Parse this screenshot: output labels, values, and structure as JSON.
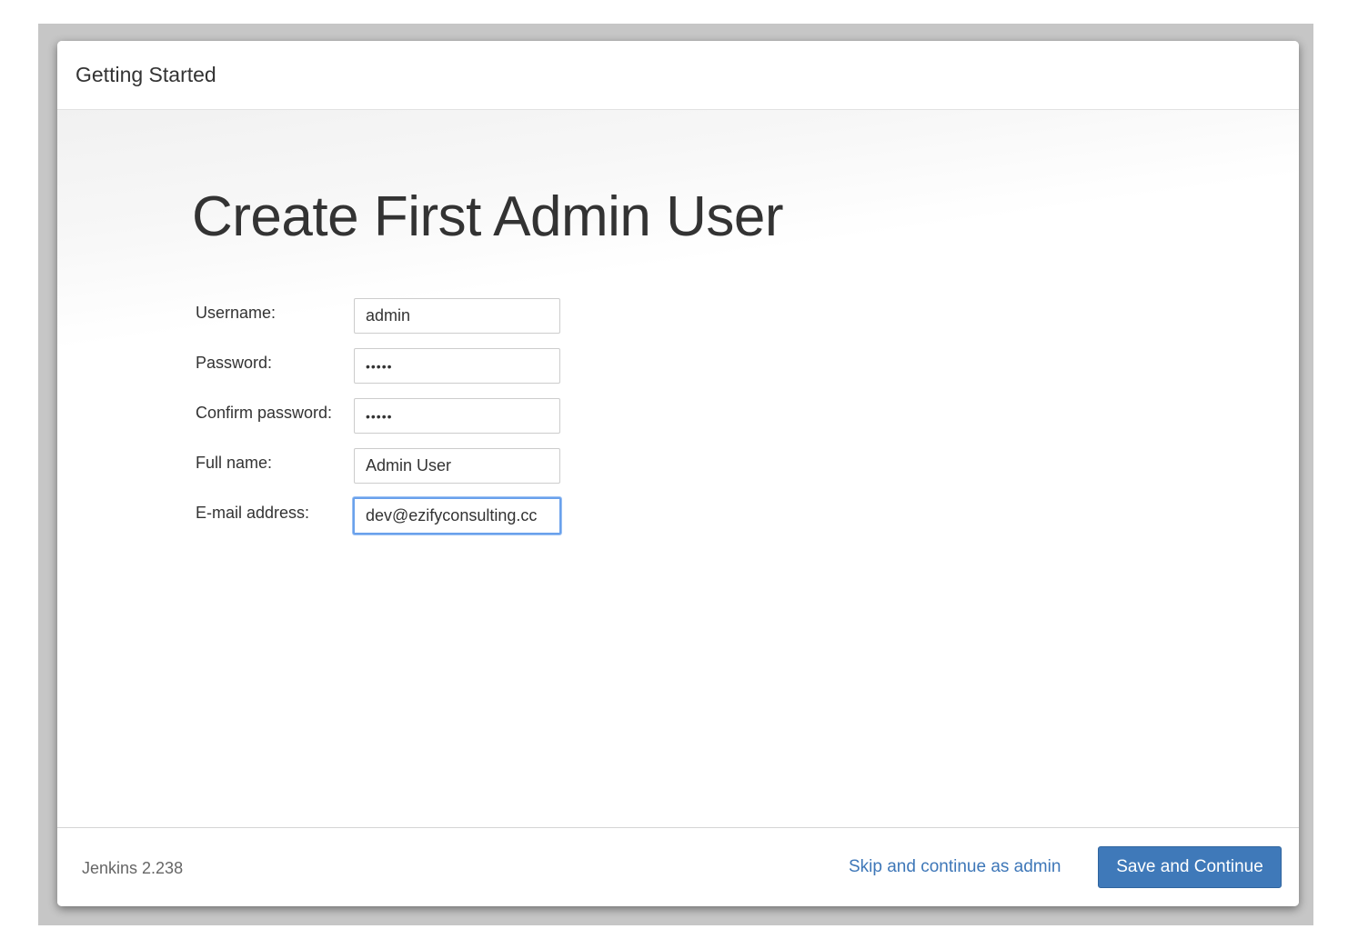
{
  "dialog": {
    "title": "Getting Started"
  },
  "page": {
    "heading": "Create First Admin User"
  },
  "form": {
    "fields": [
      {
        "label": "Username:",
        "value": "admin",
        "type": "text"
      },
      {
        "label": "Password:",
        "value": "•••••",
        "type": "password"
      },
      {
        "label": "Confirm password:",
        "value": "•••••",
        "type": "password"
      },
      {
        "label": "Full name:",
        "value": "Admin User",
        "type": "text"
      },
      {
        "label": "E-mail address:",
        "value": "dev@ezifyconsulting.cc",
        "type": "email",
        "focused": true
      }
    ]
  },
  "footer": {
    "version": "Jenkins 2.238",
    "skip_label": "Skip and continue as admin",
    "save_label": "Save and Continue"
  },
  "colors": {
    "primary_button": "#3f79b9",
    "link": "#3e77b8",
    "focus_ring": "#6aa1ec"
  }
}
